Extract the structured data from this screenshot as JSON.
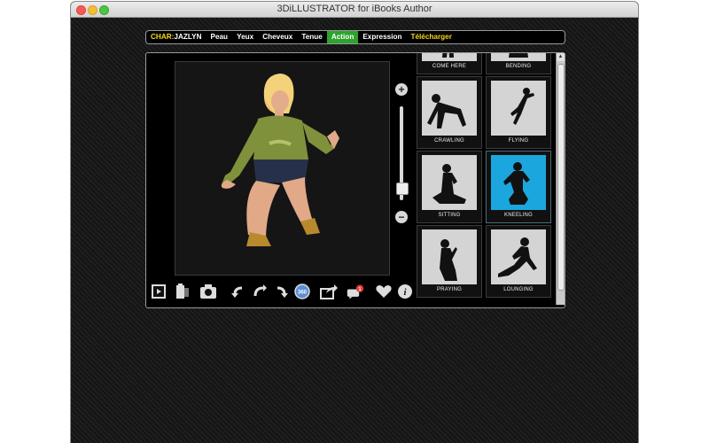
{
  "window": {
    "title": "3DiLLUSTRATOR for iBooks Author"
  },
  "menu": {
    "char_tag": "CHAR:",
    "char_name": "JAZLYN",
    "items": [
      "Peau",
      "Yeux",
      "Cheveux",
      "Tenue",
      "Action",
      "Expression"
    ],
    "active": "Action",
    "download": "Télécharger"
  },
  "zoom": {
    "plus_label": "+",
    "minus_label": "−",
    "level": 0.08
  },
  "toolbar": {
    "icons": [
      "video-icon",
      "battery-icon",
      "camera-icon",
      "rotate-left-icon",
      "rotate-reset-icon",
      "rotate-right-icon",
      "360-icon",
      "share-icon",
      "comments-icon",
      "heart-icon",
      "info-icon"
    ],
    "badge_360": "360",
    "notification_count": "1",
    "info_label": "i"
  },
  "poses": [
    {
      "label": "COME HERE",
      "selected": false
    },
    {
      "label": "BENDING",
      "selected": false
    },
    {
      "label": "CRAWLING",
      "selected": false
    },
    {
      "label": "FLYING",
      "selected": false
    },
    {
      "label": "SITTING",
      "selected": false
    },
    {
      "label": "KNEELING",
      "selected": true
    },
    {
      "label": "PRAYING",
      "selected": false
    },
    {
      "label": "LOUNGING",
      "selected": false
    }
  ],
  "colors": {
    "accent_active": "#2da32d",
    "highlight_text": "#f6d51b",
    "selected_pose": "#1ba7de",
    "badge_red": "#e23c3c"
  }
}
